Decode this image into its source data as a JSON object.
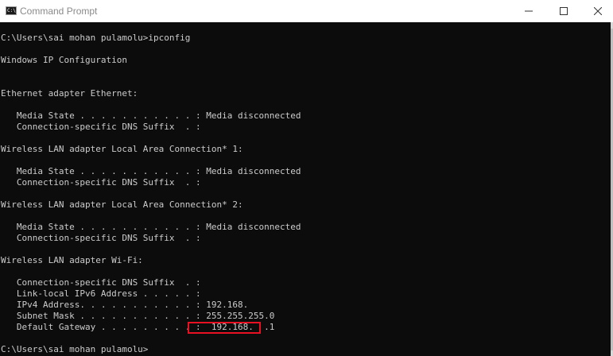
{
  "window": {
    "title": "Command Prompt",
    "icon": "cmd-app-icon",
    "icon_glyph": "C:\\"
  },
  "console": {
    "lines": [
      "C:\\Users\\sai mohan pulamolu>ipconfig",
      "",
      "Windows IP Configuration",
      "",
      "",
      "Ethernet adapter Ethernet:",
      "",
      "   Media State . . . . . . . . . . . : Media disconnected",
      "   Connection-specific DNS Suffix  . :",
      "",
      "Wireless LAN adapter Local Area Connection* 1:",
      "",
      "   Media State . . . . . . . . . . . : Media disconnected",
      "   Connection-specific DNS Suffix  . :",
      "",
      "Wireless LAN adapter Local Area Connection* 2:",
      "",
      "   Media State . . . . . . . . . . . : Media disconnected",
      "   Connection-specific DNS Suffix  . :",
      "",
      "Wireless LAN adapter Wi-Fi:",
      "",
      "   Connection-specific DNS Suffix  . :",
      "   Link-local IPv6 Address . . . . . :",
      "   IPv4 Address. . . . . . . . . . . : 192.168.",
      "   Subnet Mask . . . . . . . . . . . : 255.255.255.0",
      "   Default Gateway . . . . . . . . . :  192.168.  .1",
      "",
      "C:\\Users\\sai mohan pulamolu>"
    ]
  },
  "annotation": {
    "highlight_color": "#e81123",
    "highlighted_value": "192.168.  .1"
  },
  "colors": {
    "console_background": "#0c0c0c",
    "console_text": "#cccccc",
    "titlebar_background": "#ffffff"
  }
}
